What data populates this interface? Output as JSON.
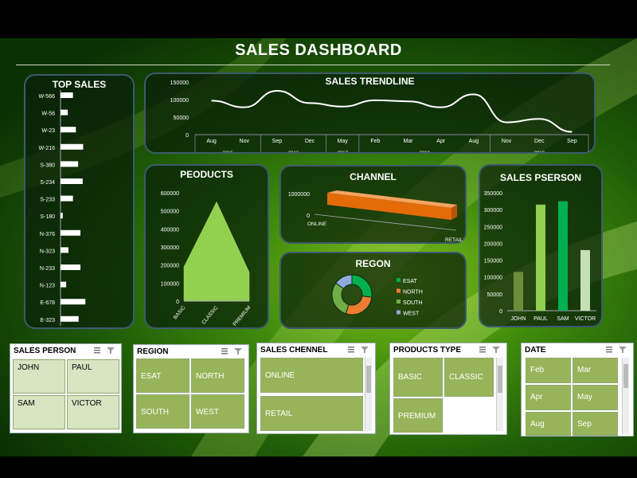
{
  "title": "SALES DASHBOARD",
  "top_sales": {
    "title": "TOP SALES",
    "x_ticks": [
      "0",
      "100000",
      "200000"
    ]
  },
  "trend": {
    "title": "SALES TRENDLINE",
    "y_ticks": [
      "150000",
      "100000",
      "50000",
      "0"
    ],
    "months": [
      "Aug",
      "Nov",
      "Sep",
      "Dec",
      "May",
      "Feb",
      "Mar",
      "Apr",
      "Aug",
      "Nov",
      "Dec",
      "Sep"
    ],
    "years": [
      "2015",
      "2016",
      "2017",
      "2018",
      "2019"
    ]
  },
  "products": {
    "title": "PEODUCTS",
    "y_ticks": [
      "600000",
      "500000",
      "400000",
      "300000",
      "200000",
      "100000",
      "0"
    ]
  },
  "channel": {
    "title": "CHANNEL",
    "tick_top": "1000000",
    "tick_zero": "0"
  },
  "region_chart": {
    "title": "REGON",
    "legend": [
      {
        "label": "ESAT",
        "color": "#00b050"
      },
      {
        "label": "NORTH",
        "color": "#ed7d31"
      },
      {
        "label": "SOUTH",
        "color": "#70ad47"
      },
      {
        "label": "WEST",
        "color": "#8faadc"
      }
    ]
  },
  "person_chart": {
    "title": "SALES PSERSON",
    "y_ticks": [
      "350000",
      "300000",
      "250000",
      "200000",
      "150000",
      "100000",
      "50000",
      "0"
    ]
  },
  "chart_data": [
    {
      "type": "bar",
      "title": "TOP SALES",
      "categories": [
        "W-566",
        "W-56",
        "W-23",
        "W-216",
        "S-380",
        "S-234",
        "S-233",
        "S-180",
        "N-376",
        "N-323",
        "N-233",
        "N-123",
        "E-678",
        "E-323"
      ],
      "values": [
        55000,
        32000,
        68000,
        100000,
        78000,
        98000,
        55000,
        10000,
        88000,
        35000,
        88000,
        25000,
        110000,
        80000
      ],
      "xlim": [
        0,
        250000
      ]
    },
    {
      "type": "line",
      "title": "SALES TRENDLINE",
      "x": [
        "Aug",
        "Nov",
        "Sep",
        "Dec",
        "May",
        "Feb",
        "Mar",
        "Apr",
        "Aug",
        "Nov",
        "Dec",
        "Sep"
      ],
      "values": [
        97000,
        78000,
        125000,
        90000,
        80000,
        98000,
        95000,
        78000,
        115000,
        35000,
        45000,
        8000
      ],
      "ylim": [
        0,
        150000
      ]
    },
    {
      "type": "area",
      "title": "PEODUCTS",
      "categories": [
        "BASIC",
        "CLASSIC",
        "PREMIUM"
      ],
      "values": [
        190000,
        550000,
        160000
      ],
      "ylim": [
        0,
        600000
      ]
    },
    {
      "type": "bar",
      "title": "CHANNEL",
      "categories": [
        "ONLINE",
        "RETAIL"
      ],
      "values": [
        1000000,
        1000000
      ]
    },
    {
      "type": "pie",
      "title": "REGON",
      "categories": [
        "ESAT",
        "NORTH",
        "SOUTH",
        "WEST"
      ],
      "values": [
        27,
        28,
        30,
        15
      ]
    },
    {
      "type": "bar",
      "title": "SALES PSERSON",
      "categories": [
        "JOHN",
        "PAUL",
        "SAM",
        "VICTOR"
      ],
      "values": [
        115000,
        315000,
        325000,
        180000
      ],
      "colors": [
        "#6b8e3a",
        "#92d050",
        "#00b050",
        "#c5e0b4"
      ],
      "ylim": [
        0,
        350000
      ]
    }
  ],
  "slicers": {
    "person": {
      "title": "SALES PERSON",
      "items": [
        "JOHN",
        "PAUL",
        "SAM",
        "VICTOR"
      ]
    },
    "region": {
      "title": "REGION",
      "items": [
        "ESAT",
        "NORTH",
        "SOUTH",
        "WEST"
      ]
    },
    "channel": {
      "title": "SALES CHENNEL",
      "items": [
        "ONLINE",
        "RETAIL"
      ]
    },
    "product": {
      "title": "PRODUCTS TYPE",
      "items": [
        "BASIC",
        "CLASSIC",
        "PREMIUM"
      ]
    },
    "date": {
      "title": "DATE",
      "items": [
        "Feb",
        "Mar",
        "Apr",
        "May",
        "Aug",
        "Sep"
      ]
    }
  }
}
